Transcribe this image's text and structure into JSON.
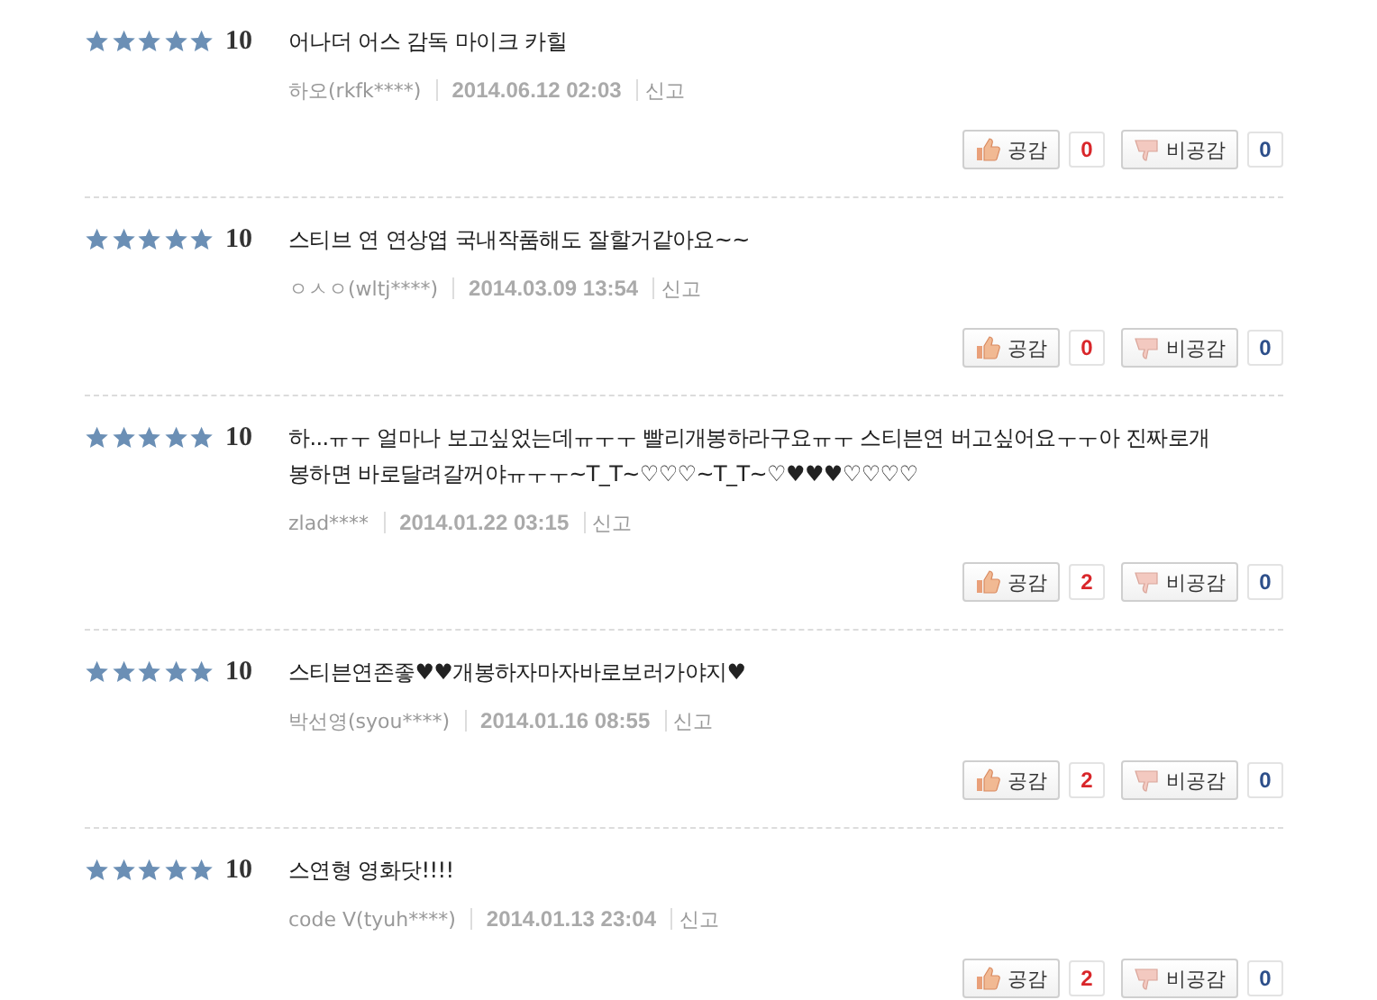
{
  "reviews": [
    {
      "stars": 5,
      "score": "10",
      "text": "어나더 어스 감독 마이크 카힐",
      "author": "하오(rkfk****)",
      "date": "2014.06.12 02:03",
      "report": "신고",
      "like_label": "공감",
      "like_count": "0",
      "dislike_label": "비공감",
      "dislike_count": "0"
    },
    {
      "stars": 5,
      "score": "10",
      "text": "스티브 연 연상엽 국내작품해도 잘할거같아요~~",
      "author": "ㅇㅅㅇ(wltj****)",
      "date": "2014.03.09 13:54",
      "report": "신고",
      "like_label": "공감",
      "like_count": "0",
      "dislike_label": "비공감",
      "dislike_count": "0"
    },
    {
      "stars": 5,
      "score": "10",
      "text": "하...ㅠㅜ 얼마나 보고싶었는데ㅠㅜㅜ 빨리개봉하라구요ㅠㅜ 스티븐연 버고싶어요ㅜㅜ아 진짜로개봉하면 바로달려갈꺼야ㅠㅜㅜ~T_T~♡♡♡~T_T~♡♥♥♥♡♡♡♡",
      "author": "zlad****",
      "date": "2014.01.22 03:15",
      "report": "신고",
      "like_label": "공감",
      "like_count": "2",
      "dislike_label": "비공감",
      "dislike_count": "0"
    },
    {
      "stars": 5,
      "score": "10",
      "text": "스티븐연존좋♥♥개봉하자마자바로보러가야지♥",
      "author": "박선영(syou****)",
      "date": "2014.01.16 08:55",
      "report": "신고",
      "like_label": "공감",
      "like_count": "2",
      "dislike_label": "비공감",
      "dislike_count": "0"
    },
    {
      "stars": 5,
      "score": "10",
      "text": "스연형 영화닷!!!!",
      "author": "code V(tyuh****)",
      "date": "2014.01.13 23:04",
      "report": "신고",
      "like_label": "공감",
      "like_count": "2",
      "dislike_label": "비공감",
      "dislike_count": "0"
    }
  ]
}
